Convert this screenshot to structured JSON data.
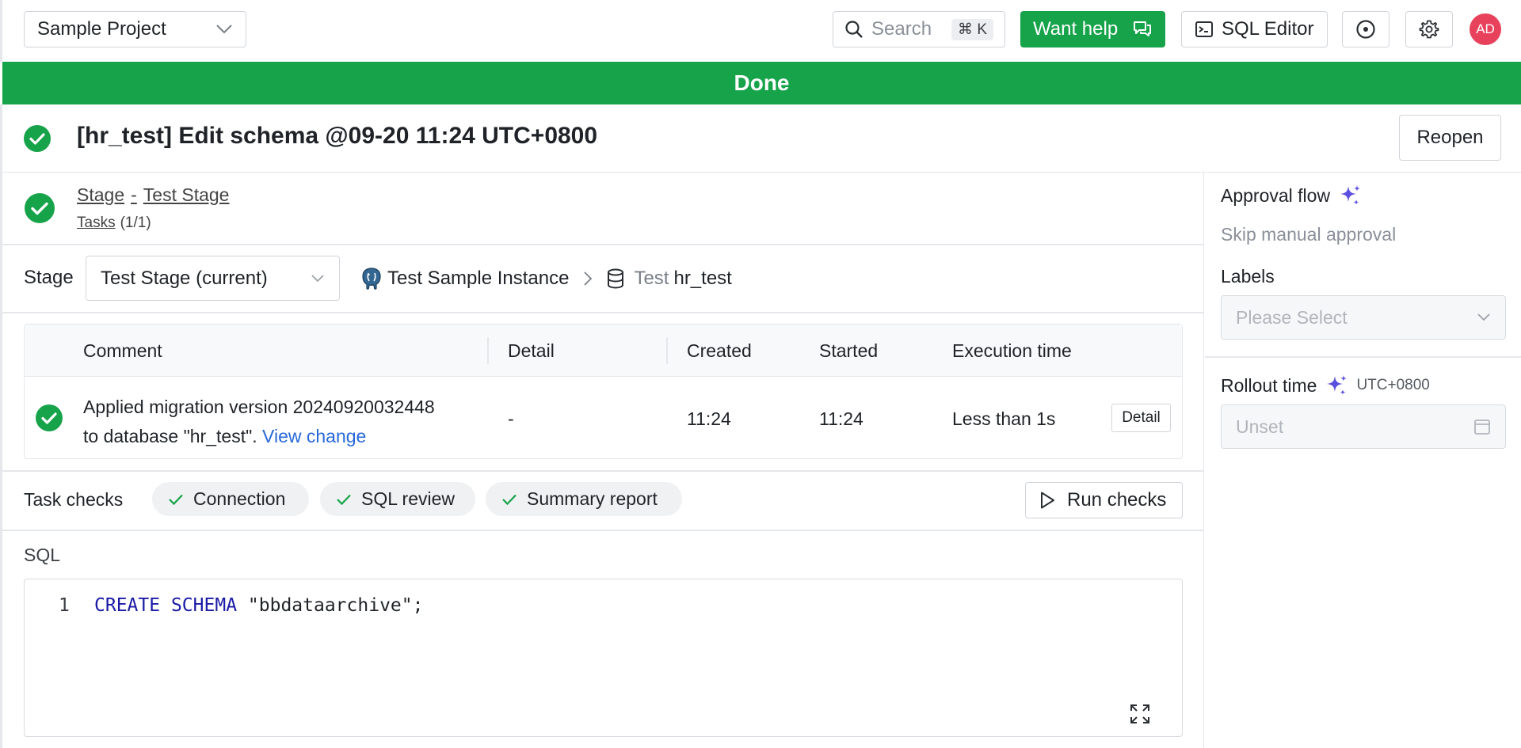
{
  "header": {
    "project": "Sample Project",
    "search_placeholder": "Search",
    "search_shortcut": "⌘ K",
    "help_label": "Want help",
    "sql_editor_label": "SQL Editor",
    "avatar_initials": "AD"
  },
  "banner": {
    "status": "Done"
  },
  "issue": {
    "title": "[hr_test] Edit schema @09-20 11:24 UTC+0800",
    "reopen_label": "Reopen"
  },
  "stage_summary": {
    "stage_word": "Stage",
    "separator": "-",
    "stage_name": "Test Stage",
    "tasks_label": "Tasks",
    "tasks_count": "(1/1)"
  },
  "stage_bar": {
    "label": "Stage",
    "selected": "Test Stage (current)",
    "instance": "Test Sample Instance",
    "env": "Test",
    "database": "hr_test"
  },
  "task_table": {
    "columns": [
      "Comment",
      "Detail",
      "Created",
      "Started",
      "Execution time"
    ],
    "rows": [
      {
        "comment_line1": "Applied migration version 20240920032448",
        "comment_line2": "to database \"hr_test\".",
        "comment_link": "View change",
        "detail": "-",
        "created": "11:24",
        "started": "11:24",
        "execution_time": "Less than 1s",
        "detail_button": "Detail"
      }
    ]
  },
  "task_checks": {
    "label": "Task checks",
    "checks": [
      "Connection",
      "SQL review",
      "Summary report"
    ],
    "run_label": "Run checks"
  },
  "sql": {
    "label": "SQL",
    "line_number": "1",
    "keyword1": "CREATE",
    "keyword2": "SCHEMA",
    "rest": "\"bbdataarchive\";"
  },
  "sidebar": {
    "approval_title": "Approval flow",
    "approval_value": "Skip manual approval",
    "labels_title": "Labels",
    "labels_placeholder": "Please Select",
    "rollout_title": "Rollout time",
    "rollout_tz": "UTC+0800",
    "rollout_placeholder": "Unset"
  },
  "colors": {
    "success": "#17a34a",
    "link": "#2868d8",
    "avatar": "#e8415b",
    "ai_sparkle": "#5b4fe0"
  }
}
